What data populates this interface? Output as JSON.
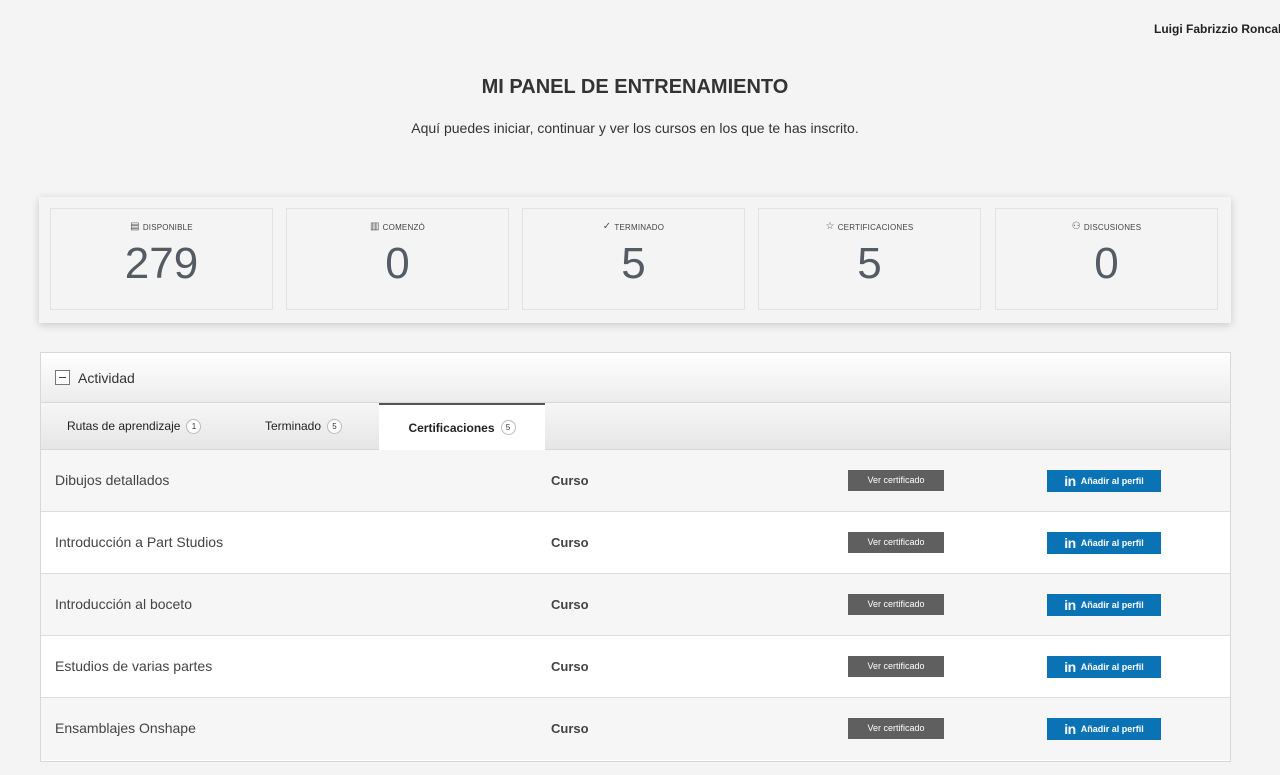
{
  "user": {
    "name": "Luigi Fabrizzio Roncalle"
  },
  "header": {
    "title": "MI PANEL DE ENTRENAMIENTO",
    "subtitle": "Aquí puedes iniciar, continuar y ver los cursos en los que te has inscrito."
  },
  "stats": [
    {
      "label": "DISPONIBLE",
      "value": "279",
      "icon": "book-icon",
      "glyph": "▤"
    },
    {
      "label": "COMENZÓ",
      "value": "0",
      "icon": "started-icon",
      "glyph": "▥"
    },
    {
      "label": "TERMINADO",
      "value": "5",
      "icon": "check-icon",
      "glyph": "✓"
    },
    {
      "label": "CERTIFICACIONES",
      "value": "5",
      "icon": "star-icon",
      "glyph": "☆"
    },
    {
      "label": "DISCUSIONES",
      "value": "0",
      "icon": "users-icon",
      "glyph": "⚇"
    }
  ],
  "activity": {
    "title": "Actividad",
    "tabs": [
      {
        "label": "Rutas de aprendizaje",
        "count": "1"
      },
      {
        "label": "Terminado",
        "count": "5"
      },
      {
        "label": "Certificaciones",
        "count": "5"
      }
    ],
    "active_tab": "Certificaciones",
    "rows": [
      {
        "title": "Dibujos detallados",
        "type": "Curso"
      },
      {
        "title": "Introducción a Part Studios",
        "type": "Curso"
      },
      {
        "title": "Introducción al boceto",
        "type": "Curso"
      },
      {
        "title": "Estudios de varias partes",
        "type": "Curso"
      },
      {
        "title": "Ensamblajes Onshape",
        "type": "Curso"
      }
    ],
    "cert_button_label": "Ver certificado",
    "linkedin_button_label": "Añadir al perfil",
    "linkedin_icon_text": "in"
  },
  "colors": {
    "background": "#f4f4f4",
    "cert_button": "#5f5f5f",
    "linkedin_button": "#0a73b6",
    "stat_value": "#555b63"
  }
}
